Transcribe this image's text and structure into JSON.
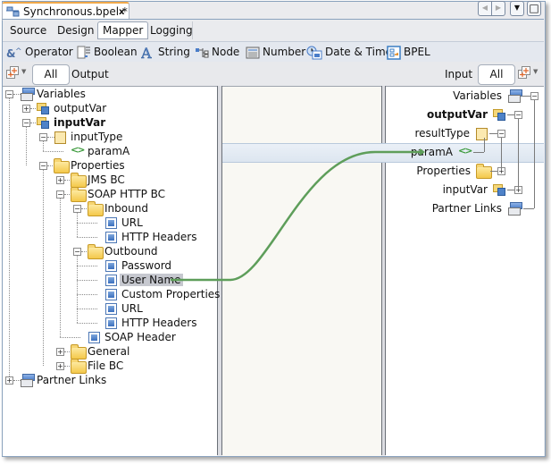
{
  "editor_tab": {
    "title": "Synchronous.bpel *",
    "close_glyph": "x",
    "active_color": "#f0a84a"
  },
  "window_buttons": {
    "prev": "◀",
    "next": "▶",
    "menu": "▼",
    "maximize": "□"
  },
  "view_tabs": [
    {
      "label": "Source",
      "active": false
    },
    {
      "label": "Design",
      "active": false
    },
    {
      "label": "Mapper",
      "active": true
    },
    {
      "label": "Logging",
      "active": false
    }
  ],
  "palette": [
    {
      "label": "Operator",
      "icon": "operator-icon"
    },
    {
      "label": "Boolean",
      "icon": "boolean-icon"
    },
    {
      "label": "String",
      "icon": "string-icon"
    },
    {
      "label": "Node",
      "icon": "node-icon"
    },
    {
      "label": "Number",
      "icon": "number-icon"
    },
    {
      "label": "Date & Time",
      "icon": "datetime-icon"
    },
    {
      "label": "BPEL",
      "icon": "bpel-icon"
    }
  ],
  "filter": {
    "output_filter_value": "All",
    "output_label": "Output",
    "input_label": "Input",
    "input_filter_value": "All"
  },
  "left_tree": [
    {
      "label": "Variables",
      "depth": 0,
      "icon": "variables-icon",
      "expander": "minus"
    },
    {
      "label": "outputVar",
      "depth": 1,
      "icon": "variable-icon",
      "expander": "plus"
    },
    {
      "label": "inputVar",
      "depth": 1,
      "icon": "variable-icon",
      "expander": "minus",
      "bold": true
    },
    {
      "label": "inputType",
      "depth": 2,
      "icon": "type-icon",
      "expander": "minus"
    },
    {
      "label": "paramA",
      "depth": 3,
      "icon": "element-icon",
      "expander": "none"
    },
    {
      "label": "Properties",
      "depth": 2,
      "icon": "folder-icon",
      "expander": "minus"
    },
    {
      "label": "JMS BC",
      "depth": 3,
      "icon": "folder-icon",
      "expander": "plus"
    },
    {
      "label": "SOAP HTTP BC",
      "depth": 3,
      "icon": "folder-icon",
      "expander": "minus"
    },
    {
      "label": "Inbound",
      "depth": 4,
      "icon": "folder-icon",
      "expander": "minus"
    },
    {
      "label": "URL",
      "depth": 5,
      "icon": "property-icon",
      "expander": "none"
    },
    {
      "label": "HTTP Headers",
      "depth": 5,
      "icon": "property-icon",
      "expander": "none"
    },
    {
      "label": "Outbound",
      "depth": 4,
      "icon": "folder-icon",
      "expander": "minus"
    },
    {
      "label": "Password",
      "depth": 5,
      "icon": "property-icon",
      "expander": "none"
    },
    {
      "label": "User Name",
      "depth": 5,
      "icon": "property-icon",
      "expander": "none",
      "selected": true
    },
    {
      "label": "Custom Properties",
      "depth": 5,
      "icon": "property-icon",
      "expander": "none"
    },
    {
      "label": "URL",
      "depth": 5,
      "icon": "property-icon",
      "expander": "none"
    },
    {
      "label": "HTTP Headers",
      "depth": 5,
      "icon": "property-icon",
      "expander": "none"
    },
    {
      "label": "SOAP Header",
      "depth": 4,
      "icon": "property-icon",
      "expander": "none"
    },
    {
      "label": "General",
      "depth": 3,
      "icon": "folder-icon",
      "expander": "plus"
    },
    {
      "label": "File BC",
      "depth": 3,
      "icon": "folder-icon",
      "expander": "plus"
    },
    {
      "label": "Partner Links",
      "depth": 0,
      "icon": "partner-links-icon",
      "expander": "plus"
    }
  ],
  "right_tree": [
    {
      "label": "Variables",
      "icon": "variables-icon",
      "expander": "minus"
    },
    {
      "label": "outputVar",
      "icon": "variable-icon",
      "expander": "minus",
      "bold": true
    },
    {
      "label": "resultType",
      "icon": "type-icon",
      "expander": "minus"
    },
    {
      "label": "paramA",
      "icon": "element-icon",
      "expander": "none",
      "highlighted": true
    },
    {
      "label": "Properties",
      "icon": "folder-icon",
      "expander": "plus"
    },
    {
      "label": "inputVar",
      "icon": "variable-icon",
      "expander": "plus"
    },
    {
      "label": "Partner Links",
      "icon": "partner-links-icon",
      "expander": "none"
    }
  ],
  "mapping": {
    "from": "inputVar/Properties/SOAP HTTP BC/Outbound/User Name",
    "to": "outputVar/resultType/paramA",
    "link_color": "#5e9e5a"
  }
}
